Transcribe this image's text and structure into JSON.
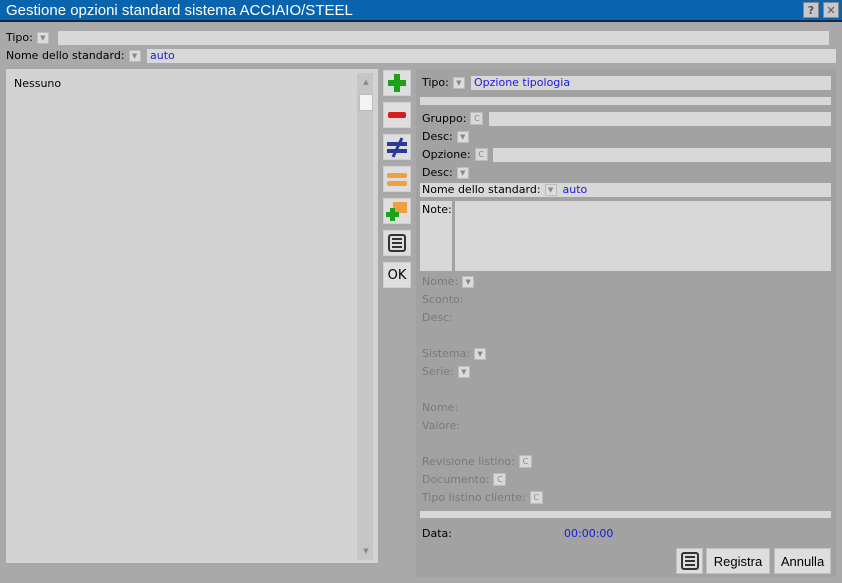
{
  "window": {
    "title": "Gestione opzioni standard sistema ACCIAIO/STEEL",
    "help_label": "?",
    "close_label": "✕"
  },
  "top": {
    "tipo_label": "Tipo:",
    "nome_standard_label": "Nome dello standard:",
    "nome_standard_value": "auto"
  },
  "list": {
    "items": [
      "Nessuno"
    ]
  },
  "toolbar": {
    "ok_label": "OK"
  },
  "form": {
    "tipo_label": "Tipo:",
    "tipo_value": "Opzione tipologia",
    "gruppo_label": "Gruppo:",
    "desc1_label": "Desc:",
    "opzione_label": "Opzione:",
    "desc2_label": "Desc:",
    "nome_standard_label": "Nome dello standard:",
    "nome_standard_value": "auto",
    "note_label": "Note:",
    "nome1_label": "Nome:",
    "sconto_label": "Sconto:",
    "desc3_label": "Desc:",
    "sistema_label": "Sistema:",
    "serie_label": "Serie:",
    "nome2_label": "Nome:",
    "valore_label": "Valore:",
    "revisione_label": "Revisione listino:",
    "documento_label": "Documento:",
    "tipo_listino_label": "Tipo listino cliente:",
    "data_label": "Data:",
    "data_value": "00:00:00",
    "c_glyph": "C",
    "dd_glyph": "▼"
  },
  "buttons": {
    "registra_label": "Registra",
    "annulla_label": "Annulla"
  },
  "colors": {
    "titlebar": "#0a64ad",
    "value_blue": "#1a1adc",
    "add_green": "#1aa31a",
    "remove_red": "#d81c1c",
    "compare_blue": "#2a3a9a",
    "equal_orange": "#f0a040"
  }
}
